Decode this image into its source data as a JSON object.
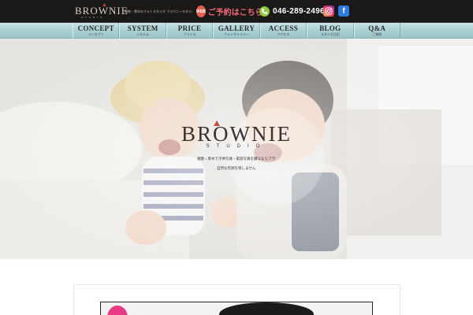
{
  "header": {
    "logo": "BROWNIE",
    "logo_sub": "STUDIO",
    "tagline": "湘南・厚木のフォトスタジオ ブラウニースタジオ",
    "reserve_icon": "WEB",
    "reserve_label": "ご予約はこちら",
    "phone_number": "046-289-2496",
    "facebook_glyph": "f",
    "icons": [
      "web-reserve-icon",
      "phone-icon",
      "instagram-icon",
      "facebook-icon"
    ]
  },
  "nav": {
    "items": [
      {
        "en": "CONCEPT",
        "jp": "コンセプト"
      },
      {
        "en": "SYSTEM",
        "jp": "システム"
      },
      {
        "en": "PRICE",
        "jp": "プライス"
      },
      {
        "en": "GALLERY",
        "jp": "フォトギャラリー"
      },
      {
        "en": "ACCESS",
        "jp": "アクセス"
      },
      {
        "en": "BLOG",
        "jp": "スタジオ日記"
      },
      {
        "en": "Q&A",
        "jp": "ご質問"
      }
    ]
  },
  "hero": {
    "logo": "BROWNIE",
    "logo_sub": "STUDIO",
    "line1": "湘南・厚木で子供写真・家族写真を撮るならブラウニースタジオへ",
    "line2": "自然な笑顔を残しませんか"
  },
  "colors": {
    "topbar": "#1b1918",
    "nav": "#a9cfd2",
    "reserve_pink": "#f06a7b",
    "phone_green": "#8dc63f",
    "facebook_blue": "#2d7be0",
    "logo_accent": "#c44a3e"
  }
}
